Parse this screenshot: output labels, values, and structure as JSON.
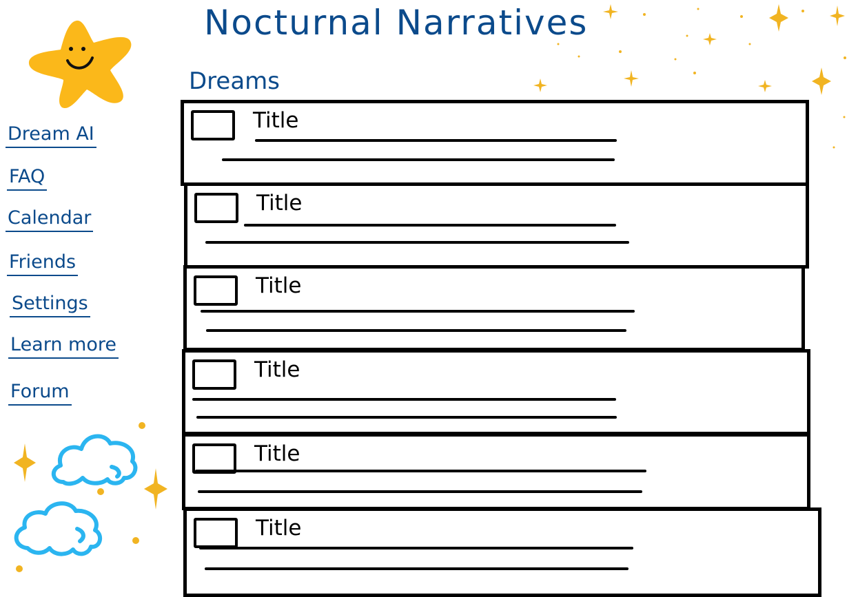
{
  "app": {
    "title": "Nocturnal Narratives"
  },
  "main": {
    "section_title": "Dreams",
    "cards": [
      {
        "title": "Title"
      },
      {
        "title": "Title"
      },
      {
        "title": "Title"
      },
      {
        "title": "Title"
      },
      {
        "title": "Title"
      },
      {
        "title": "Title"
      }
    ]
  },
  "sidebar": {
    "items": [
      {
        "label": "Dream AI"
      },
      {
        "label": "FAQ"
      },
      {
        "label": "Calendar"
      },
      {
        "label": "Friends"
      },
      {
        "label": "Settings"
      },
      {
        "label": "Learn more"
      },
      {
        "label": "Forum"
      }
    ]
  },
  "icons": {
    "logo": "smiling-star-icon",
    "decorations": [
      "sparkle-icon",
      "cloud-icon",
      "dot-icon"
    ],
    "thumbnail": "image-placeholder-icon"
  },
  "colors": {
    "ink_blue": "#0b4a8b",
    "star_yellow": "#fbb81a",
    "sparkle_gold": "#f1b422",
    "cloud_blue": "#2bb5f0",
    "card_border": "#000000"
  }
}
